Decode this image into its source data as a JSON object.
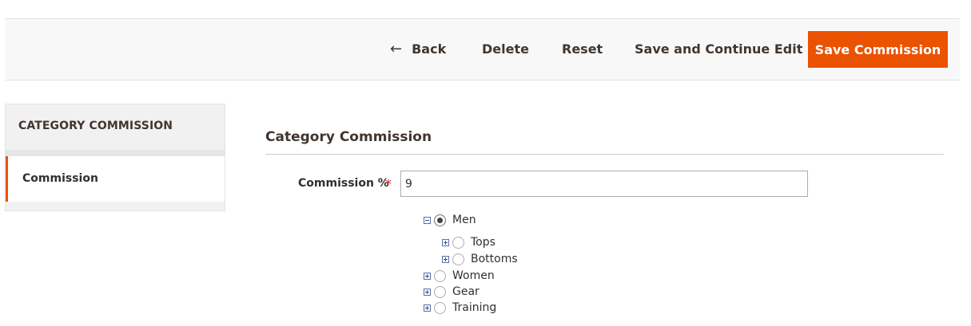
{
  "toolbar": {
    "back_label": "Back",
    "back_icon": "arrow-left-icon",
    "delete_label": "Delete",
    "reset_label": "Reset",
    "save_continue_label": "Save and Continue Edit",
    "save_label": "Save Commission",
    "accent_color": "#eb5202"
  },
  "sidebar": {
    "title": "CATEGORY COMMISSION",
    "items": [
      {
        "label": "Commission",
        "active": true
      }
    ]
  },
  "main": {
    "section_title": "Category Commission",
    "commission_field": {
      "label": "Commission %",
      "required_mark": "*",
      "value": "9"
    },
    "category_tree": [
      {
        "label": "Men",
        "expanded": true,
        "selected": true,
        "children": [
          {
            "label": "Tops",
            "expanded": false,
            "selected": false
          },
          {
            "label": "Bottoms",
            "expanded": false,
            "selected": false
          }
        ]
      },
      {
        "label": "Women",
        "expanded": false,
        "selected": false
      },
      {
        "label": "Gear",
        "expanded": false,
        "selected": false
      },
      {
        "label": "Training",
        "expanded": false,
        "selected": false
      }
    ]
  }
}
